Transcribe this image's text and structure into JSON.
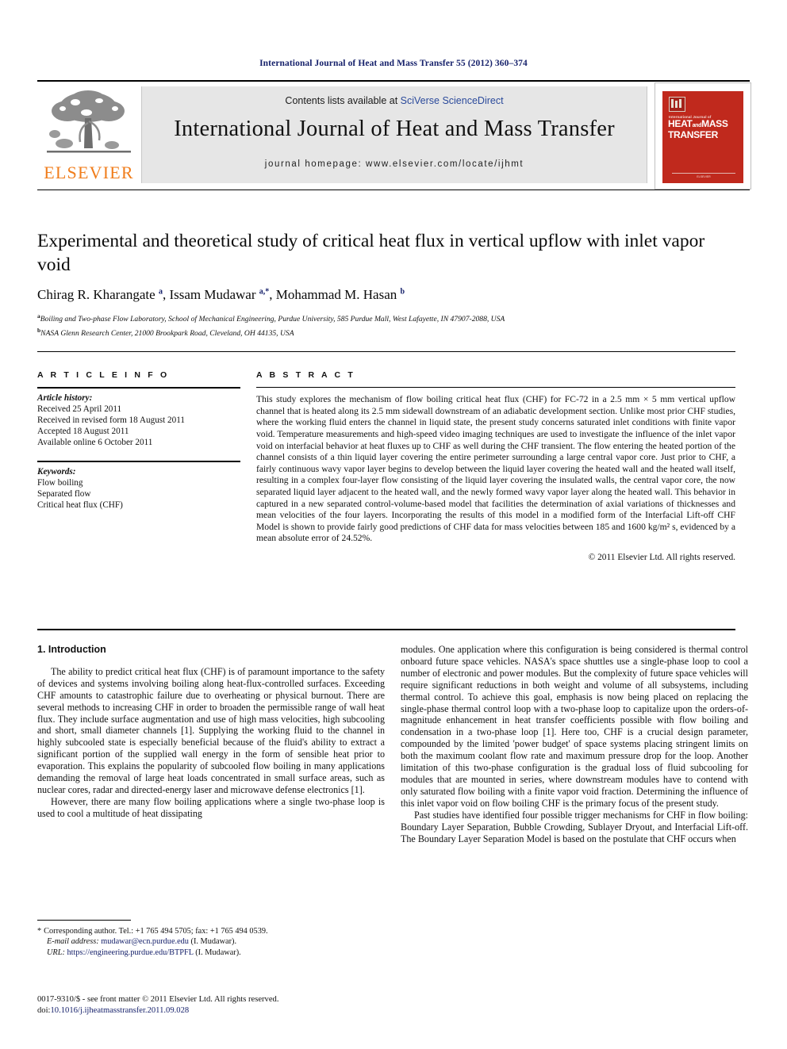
{
  "running_head": "International Journal of Heat and Mass Transfer 55 (2012) 360–374",
  "masthead": {
    "contents_prefix": "Contents lists available at ",
    "sciencedirect": "SciVerse ScienceDirect",
    "journal_title": "International Journal of Heat and Mass Transfer",
    "homepage": "journal homepage: www.elsevier.com/locate/ijhmt",
    "publisher_logo_text": "ELSEVIER",
    "cover": {
      "line_small": "International Journal of",
      "heat": "HEAT",
      "and": "and",
      "mass": "MASS",
      "transfer": "TRANSFER",
      "footer": "ELSEVIER"
    }
  },
  "article": {
    "title": "Experimental and theoretical study of critical heat flux in vertical upflow with inlet vapor void",
    "authors_html": "Chirag R. Kharangate <sup>a</sup>, Issam Mudawar <sup>a,*</sup>, Mohammad M. Hasan <sup>b</sup>",
    "affiliation_a": "Boiling and Two-phase Flow Laboratory, School of Mechanical Engineering, Purdue University, 585 Purdue Mall, West Lafayette, IN 47907-2088, USA",
    "affiliation_b": "NASA Glenn Research Center, 21000 Brookpark Road, Cleveland, OH 44135, USA",
    "affiliation_a_marker": "a",
    "affiliation_b_marker": "b"
  },
  "info": {
    "heading": "A R T I C L E   I N F O",
    "history_label": "Article history:",
    "history": [
      "Received 25 April 2011",
      "Received in revised form 18 August 2011",
      "Accepted 18 August 2011",
      "Available online 6 October 2011"
    ],
    "keywords_label": "Keywords:",
    "keywords": [
      "Flow boiling",
      "Separated flow",
      "Critical heat flux (CHF)"
    ]
  },
  "abstract": {
    "heading": "A B S T R A C T",
    "text": "This study explores the mechanism of flow boiling critical heat flux (CHF) for FC-72 in a 2.5 mm × 5 mm vertical upflow channel that is heated along its 2.5 mm sidewall downstream of an adiabatic development section. Unlike most prior CHF studies, where the working fluid enters the channel in liquid state, the present study concerns saturated inlet conditions with finite vapor void. Temperature measurements and high-speed video imaging techniques are used to investigate the influence of the inlet vapor void on interfacial behavior at heat fluxes up to CHF as well during the CHF transient. The flow entering the heated portion of the channel consists of a thin liquid layer covering the entire perimeter surrounding a large central vapor core. Just prior to CHF, a fairly continuous wavy vapor layer begins to develop between the liquid layer covering the heated wall and the heated wall itself, resulting in a complex four-layer flow consisting of the liquid layer covering the insulated walls, the central vapor core, the now separated liquid layer adjacent to the heated wall, and the newly formed wavy vapor layer along the heated wall. This behavior in captured in a new separated control-volume-based model that facilities the determination of axial variations of thicknesses and mean velocities of the four layers. Incorporating the results of this model in a modified form of the Interfacial Lift-off CHF Model is shown to provide fairly good predictions of CHF data for mass velocities between 185 and 1600 kg/m² s, evidenced by a mean absolute error of 24.52%.",
    "copyright": "© 2011 Elsevier Ltd. All rights reserved."
  },
  "body": {
    "section_heading": "1. Introduction",
    "left_paragraphs": [
      "The ability to predict critical heat flux (CHF) is of paramount importance to the safety of devices and systems involving boiling along heat-flux-controlled surfaces. Exceeding CHF amounts to catastrophic failure due to overheating or physical burnout. There are several methods to increasing CHF in order to broaden the permissible range of wall heat flux. They include surface augmentation and use of high mass velocities, high subcooling and short, small diameter channels [1]. Supplying the working fluid to the channel in highly subcooled state is especially beneficial because of the fluid's ability to extract a significant portion of the supplied wall energy in the form of sensible heat prior to evaporation. This explains the popularity of subcooled flow boiling in many applications demanding the removal of large heat loads concentrated in small surface areas, such as nuclear cores, radar and directed-energy laser and microwave defense electronics [1].",
      "However, there are many flow boiling applications where a single two-phase loop is used to cool a multitude of heat dissipating"
    ],
    "right_paragraphs": [
      "modules. One application where this configuration is being considered is thermal control onboard future space vehicles. NASA's space shuttles use a single-phase loop to cool a number of electronic and power modules. But the complexity of future space vehicles will require significant reductions in both weight and volume of all subsystems, including thermal control. To achieve this goal, emphasis is now being placed on replacing the single-phase thermal control loop with a two-phase loop to capitalize upon the orders-of-magnitude enhancement in heat transfer coefficients possible with flow boiling and condensation in a two-phase loop [1]. Here too, CHF is a crucial design parameter, compounded by the limited 'power budget' of space systems placing stringent limits on both the maximum coolant flow rate and maximum pressure drop for the loop. Another limitation of this two-phase configuration is the gradual loss of fluid subcooling for modules that are mounted in series, where downstream modules have to contend with only saturated flow boiling with a finite vapor void fraction. Determining the influence of this inlet vapor void on flow boiling CHF is the primary focus of the present study.",
      "Past studies have identified four possible trigger mechanisms for CHF in flow boiling: Boundary Layer Separation, Bubble Crowding, Sublayer Dryout, and Interfacial Lift-off. The Boundary Layer Separation Model is based on the postulate that CHF occurs when"
    ]
  },
  "footnotes": {
    "corresponding": "Corresponding author. Tel.: +1 765 494 5705; fax: +1 765 494 0539.",
    "email_label": "E-mail address:",
    "email": "mudawar@ecn.purdue.edu",
    "email_author": "(I. Mudawar).",
    "url_label": "URL:",
    "url": "https://engineering.purdue.edu/BTPFL",
    "url_author": "(I. Mudawar).",
    "issn_line": "0017-9310/$ - see front matter © 2011 Elsevier Ltd. All rights reserved.",
    "doi_label": "doi:",
    "doi": "10.1016/j.ijheatmasstransfer.2011.09.028"
  },
  "colors": {
    "link": "#16216b",
    "elsevier_orange": "#f07d1b",
    "cover_red": "#c0291d",
    "masthead_grey": "#e6e6e6"
  }
}
